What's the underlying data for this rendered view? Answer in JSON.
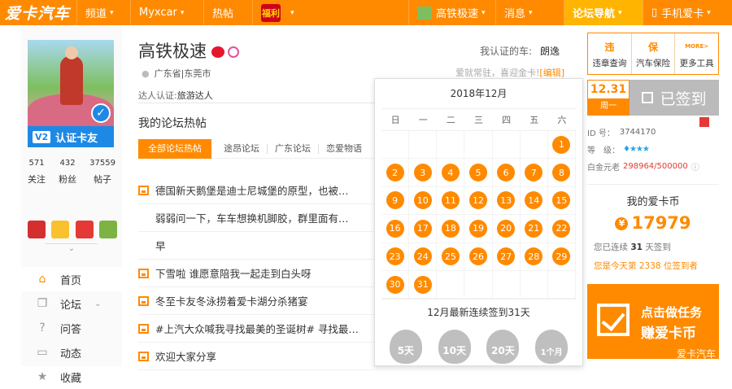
{
  "topbar": {
    "logo": "爱卡汽车",
    "nav_channel": "频道",
    "nav_myxcar": "Myxcar",
    "nav_hot": "热帖",
    "nav_fortune": "福利",
    "nav_user": "高铁极速",
    "nav_messages": "消息",
    "nav_forum": "论坛导航",
    "nav_mobile": "手机爱卡"
  },
  "sidebar": {
    "badge_v": "V2",
    "badge_text": "认证卡友",
    "stats": [
      {
        "value": "571",
        "label": "关注"
      },
      {
        "value": "432",
        "label": "粉丝"
      },
      {
        "value": "37559",
        "label": "帖子"
      }
    ],
    "menu": [
      {
        "icon": "home-icon",
        "label": "首页"
      },
      {
        "icon": "forum-icon",
        "label": "论坛"
      },
      {
        "icon": "question-icon",
        "label": "问答"
      },
      {
        "icon": "chat-icon",
        "label": "动态"
      },
      {
        "icon": "star-icon",
        "label": "收藏"
      }
    ]
  },
  "profile": {
    "name": "高铁极速",
    "location": "广东省|东莞市",
    "cert_car_label": "我认证的车:",
    "cert_car": "朗逸",
    "welcome": "爱就常驻，喜迎金卡!",
    "edit": "[编辑]",
    "talent_label": "达人认证:",
    "talent_value": "旅游达人",
    "hot_title": "我的论坛热帖"
  },
  "tabs": [
    "全部论坛热帖",
    "途昂论坛",
    "广东论坛",
    "恋爱物语"
  ],
  "posts": [
    {
      "title": "德国新天鹅堡是迪士尼城堡的原型，也被…",
      "pic": true
    },
    {
      "title": "弱弱问一下，车车想换机脚胶，群里面有…",
      "pic": false
    },
    {
      "title": "早",
      "pic": false
    },
    {
      "title": "下雪啦 谁愿意陪我一起走到白头呀",
      "pic": true
    },
    {
      "title": "冬至卡友冬泳捞着爱卡湖分杀猪宴",
      "pic": true
    },
    {
      "title": "#上汽大众喊我寻找最美的圣诞树# 寻找最…",
      "pic": true
    },
    {
      "title": "欢迎大家分享",
      "pic": true
    }
  ],
  "calendar": {
    "title": "2018年12月",
    "weekdays": [
      "日",
      "一",
      "二",
      "三",
      "四",
      "五",
      "六"
    ],
    "first_weekday": 6,
    "days": 31,
    "streak": "12月最新连续签到31天",
    "rewards": [
      "5天",
      "10天",
      "20天",
      "1个月"
    ]
  },
  "tools": [
    {
      "icon": "违",
      "label": "违章查询"
    },
    {
      "icon": "保",
      "label": "汽车保险"
    },
    {
      "icon": "MORE>",
      "label": "更多工具"
    }
  ],
  "sign": {
    "date": "12.31",
    "weekday": "周一",
    "status": "已签到"
  },
  "account": {
    "id_label": "ID 号：",
    "id_value": "3744170",
    "level_label": "等　级：",
    "gold_label": "白金元老",
    "gold_value": "298964/500000",
    "coins_title": "我的爱卡币",
    "coins_value": "17979",
    "streak_text_1": "您已连续",
    "streak_days": "31",
    "streak_text_2": "天签到",
    "rank_text": "您是今天第 2338 位签到者"
  },
  "task": {
    "line1": "点击做任务",
    "line2": "赚爱卡币",
    "watermark": "爱卡汽车"
  },
  "colors": {
    "brand": "#ff8a00",
    "verify_blue": "#1e88e5"
  }
}
